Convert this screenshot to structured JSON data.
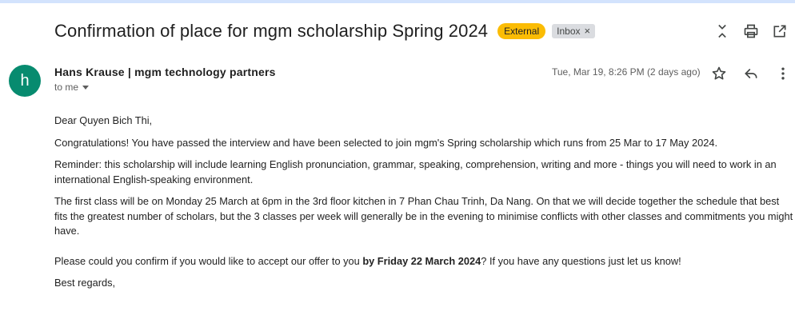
{
  "subject": "Confirmation of place for mgm scholarship Spring 2024",
  "labels": {
    "external": "External",
    "inbox": "Inbox",
    "remove": "×"
  },
  "sender": {
    "avatar_letter": "h",
    "name": "Hans Krause | mgm technology partners",
    "to": "to me",
    "date": "Tue, Mar 19, 8:26 PM (2 days ago)"
  },
  "body": {
    "greeting": "Dear Quyen Bich Thi,",
    "p1": "Congratulations! You have passed the interview and have been selected to join mgm's Spring scholarship which runs from 25 Mar to 17 May 2024.",
    "p2": "Reminder: this scholarship will include learning English pronunciation, grammar, speaking, comprehension, writing and more - things you will need to work in an international English-speaking environment.",
    "p3": "The first class will be on Monday 25 March at 6pm in the 3rd floor kitchen in 7 Phan Chau Trinh, Da Nang. On that we will decide together the schedule that best fits the greatest number of scholars, but the 3 classes per week will generally be in the evening to minimise conflicts with other classes and commitments you might have.",
    "p4_before": "Please could you confirm if you would like to accept our offer to you ",
    "p4_bold": "by Friday 22 March 2024",
    "p4_after": "? If you have any questions just let us know!",
    "closing": "Best regards,"
  },
  "colors": {
    "avatar": "#078b6f",
    "external_badge": "#fbbc04",
    "inbox_badge": "#dadce0"
  }
}
